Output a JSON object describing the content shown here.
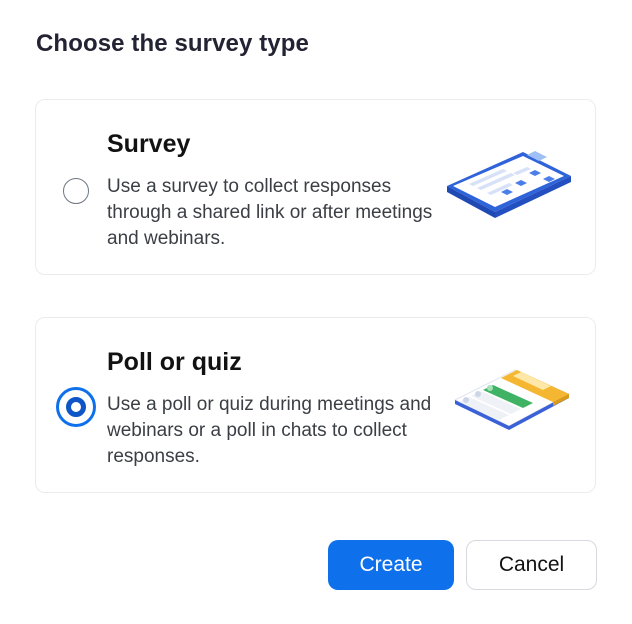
{
  "dialog": {
    "title": "Choose the survey type"
  },
  "options": [
    {
      "title": "Survey",
      "description": "Use a survey to collect responses through a shared link or after meetings and webinars.",
      "selected": false,
      "icon": "clipboard-illustration"
    },
    {
      "title": "Poll or quiz",
      "description": "Use a poll or quiz during meetings and webinars or a poll in chats to collect responses.",
      "selected": true,
      "icon": "poll-card-illustration"
    }
  ],
  "buttons": {
    "create": "Create",
    "cancel": "Cancel"
  },
  "colors": {
    "accent": "#0e71eb",
    "radio_fill": "#0e56c8",
    "illustration_yellow": "#f5b731",
    "illustration_green": "#3fb363"
  }
}
